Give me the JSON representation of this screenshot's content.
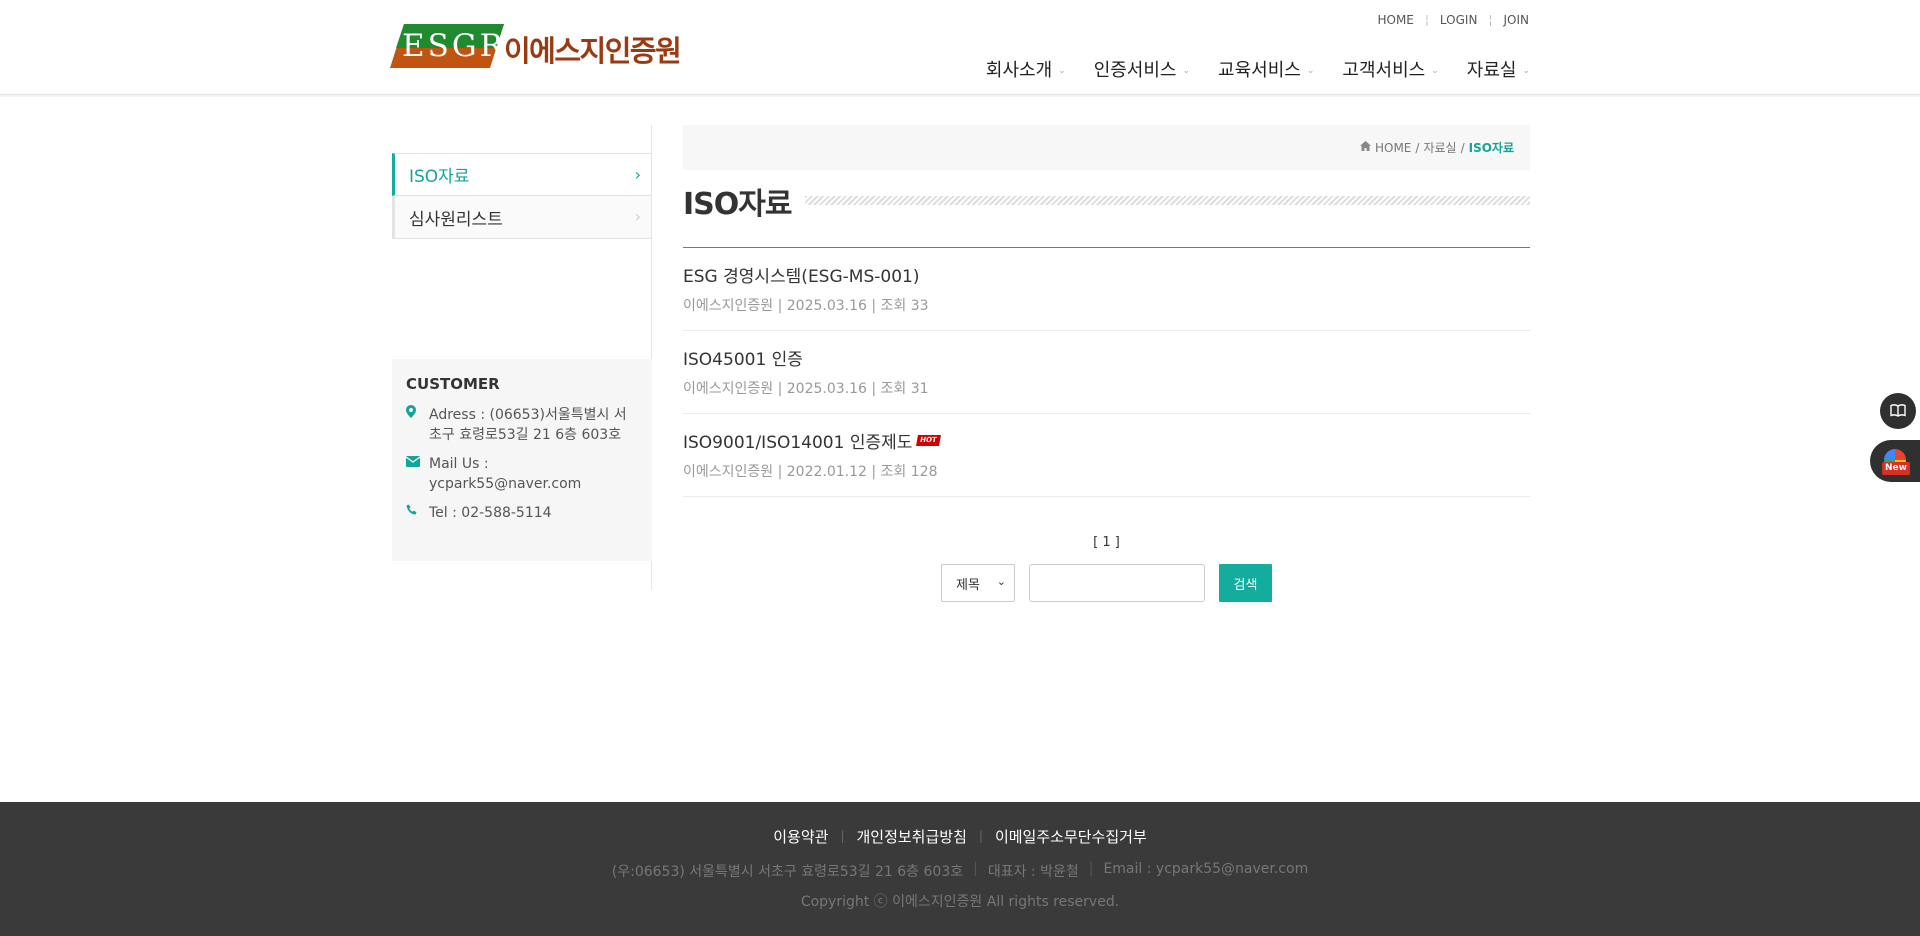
{
  "header": {
    "logo": {
      "badge_text": "ESGR",
      "name": "이에스지인증원",
      "badge_color": "#1f8a2e",
      "name_color": "#9a3a12"
    },
    "top_menu": [
      "HOME",
      "LOGIN",
      "JOIN"
    ],
    "gnb": [
      "회사소개",
      "인증서비스",
      "교육서비스",
      "고객서비스",
      "자료실"
    ]
  },
  "sidebar": {
    "items": [
      {
        "label": "ISO자료",
        "active": true
      },
      {
        "label": "심사원리스트",
        "active": false
      }
    ],
    "customer": {
      "title": "CUSTOMER",
      "address": "Adress : (06653)서울특별시 서초구 효령로53길 21 6층 603호",
      "mail": "Mail Us : ycpark55@naver.com",
      "tel": "Tel : 02-588-5114"
    }
  },
  "breadcrumb": {
    "home": "HOME",
    "section": "자료실",
    "current": "ISO자료"
  },
  "page_title": "ISO자료",
  "posts": [
    {
      "title": "ESG 경영시스템(ESG-MS-001)",
      "meta": "이에스지인증원 | 2025.03.16 | 조회 33",
      "hot": false
    },
    {
      "title": "ISO45001 인증",
      "meta": "이에스지인증원 | 2025.03.16 | 조회 31",
      "hot": false
    },
    {
      "title": "ISO9001/ISO14001 인증제도",
      "meta": "이에스지인증원 | 2022.01.12 | 조회 128",
      "hot": true,
      "hot_label": "HOT"
    }
  ],
  "paging": "[ 1 ]",
  "search": {
    "select_value": "제목",
    "input_value": "",
    "button": "검색"
  },
  "floating": {
    "new_badge": "New"
  },
  "footer": {
    "links": [
      "이용약관",
      "개인정보취급방침",
      "이메일주소무단수집거부"
    ],
    "address": "(우:06653) 서울특별시 서초구 효령로53길 21 6층 603호",
    "ceo": "대표자 : 박윤철",
    "email": "Email : ycpark55@naver.com",
    "copyright": "Copyright ⓒ 이에스지인증원 All rights reserved."
  },
  "accent_color": "#14a598"
}
